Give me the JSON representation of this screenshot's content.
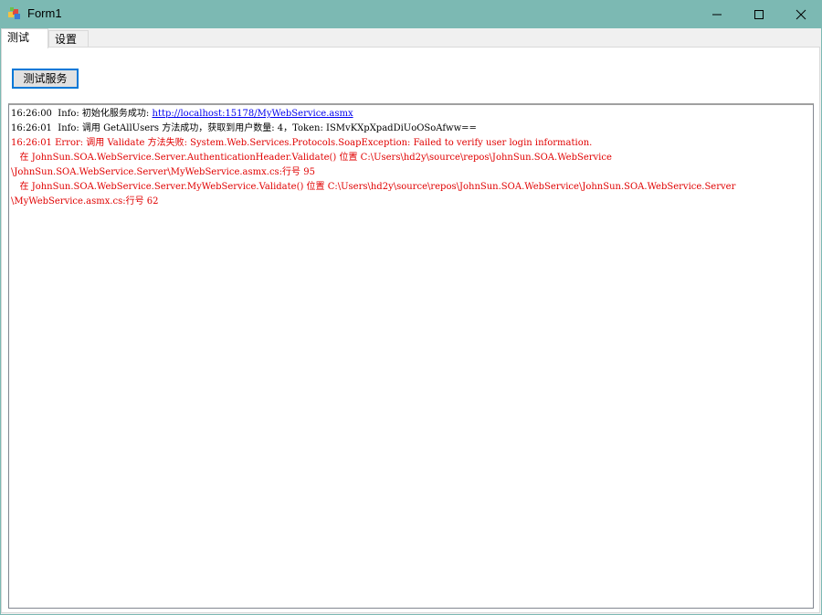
{
  "window": {
    "title": "Form1",
    "icon": "windows-form-icon",
    "controls": [
      "minimize-icon",
      "maximize-icon",
      "close-icon"
    ]
  },
  "tabs": [
    {
      "label": "测试",
      "active": true
    },
    {
      "label": "设置",
      "active": false
    }
  ],
  "actions": {
    "test_button": "测试服务"
  },
  "log": {
    "line1_prefix": "16:26:00  Info: 初始化服务成功:",
    "line1_link": "http://localhost:15178/MyWebService.asmx",
    "line2": "16:26:01  Info: 调用 GetAllUsers 方法成功，获取到用户数量: 4，Token: ISMvKXpXpadDiUoOSoAfww==",
    "line3": "16:26:01 Error: 调用 Validate 方法失败: System.Web.Services.Protocols.SoapException: Failed to verify user login information.",
    "line4": "   在 JohnSun.SOA.WebService.Server.AuthenticationHeader.Validate() 位置 C:\\Users\\hd2y\\source\\repos\\JohnSun.SOA.WebService",
    "line5": "\\JohnSun.SOA.WebService.Server\\MyWebService.asmx.cs:行号 95",
    "line6": "   在 JohnSun.SOA.WebService.Server.MyWebService.Validate() 位置 C:\\Users\\hd2y\\source\\repos\\JohnSun.SOA.WebService\\JohnSun.SOA.WebService.Server",
    "line7": "\\MyWebService.asmx.cs:行号 62"
  },
  "colors": {
    "titlebar": "#7cb9b3",
    "error_text": "#e00000",
    "link_text": "#0000ee",
    "button_border": "#0078d7"
  }
}
